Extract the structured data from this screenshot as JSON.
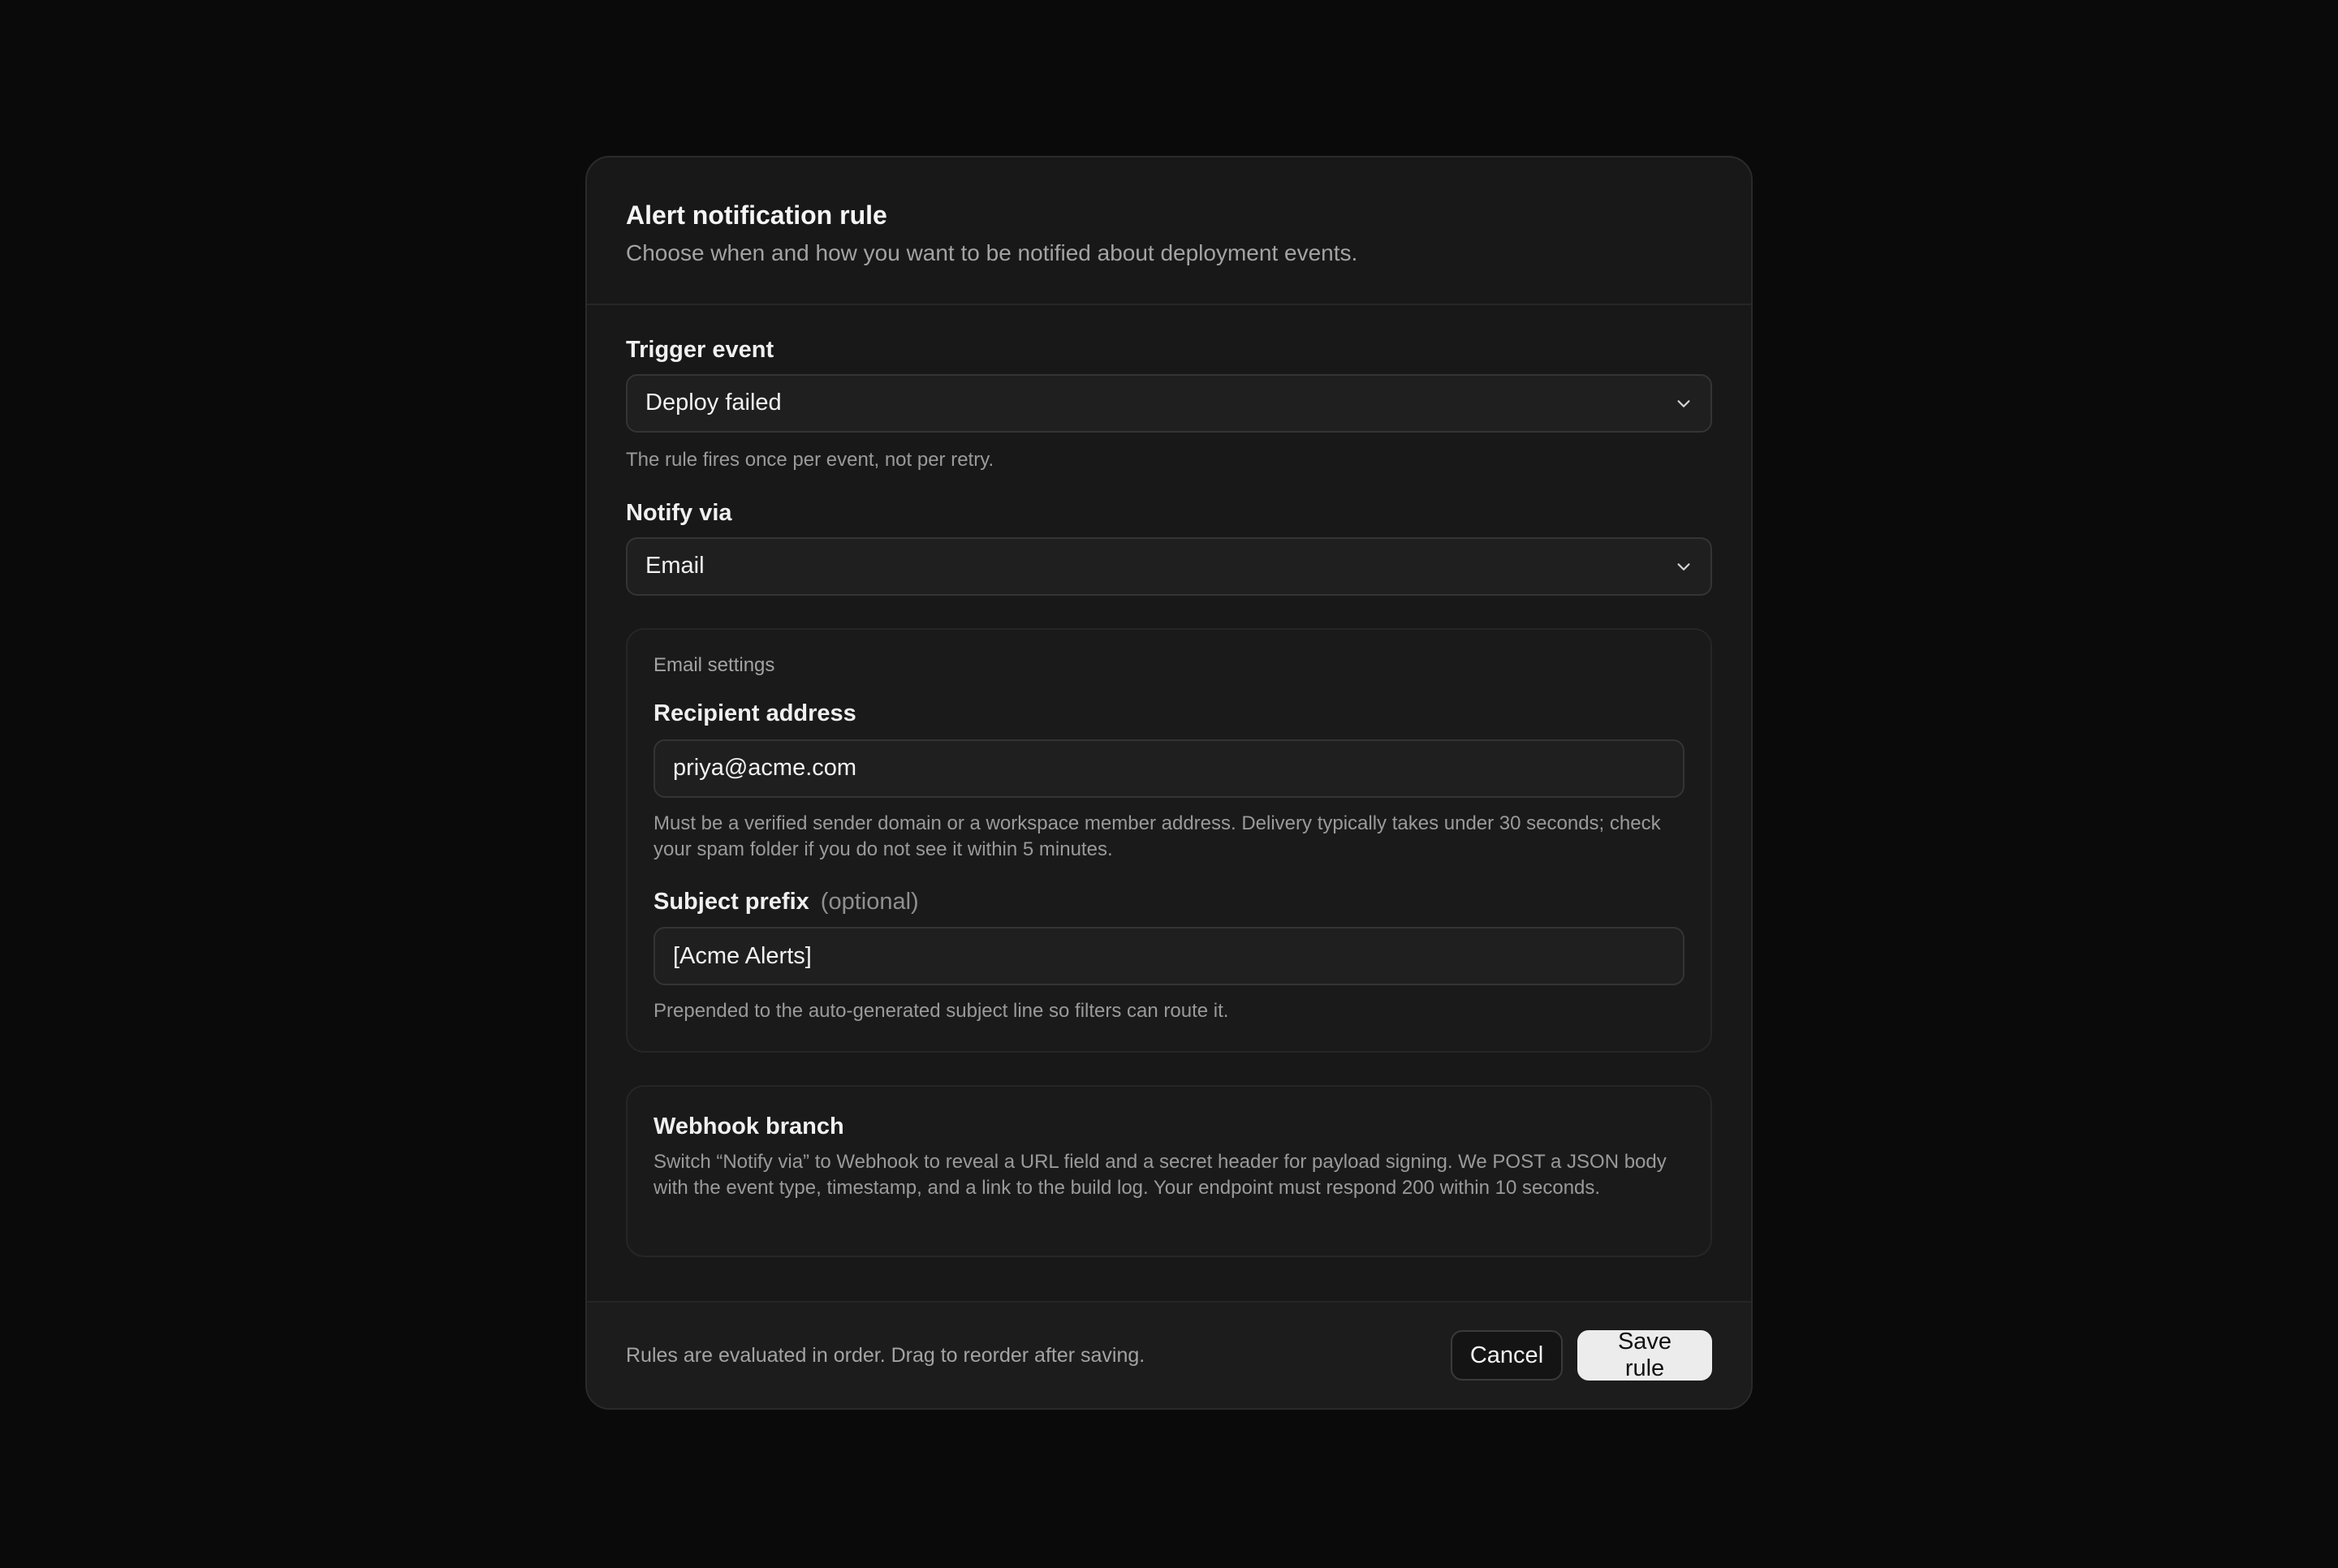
{
  "dialog": {
    "title": "Alert notification rule",
    "subtitle": "Choose when and how you want to be notified about deployment events."
  },
  "trigger": {
    "label": "Trigger event",
    "selected": "Deploy failed",
    "helper": "The rule fires once per event, not per retry."
  },
  "notify": {
    "label": "Notify via",
    "selected": "Email"
  },
  "email_settings": {
    "caption": "Email settings",
    "recipient_label": "Recipient address",
    "recipient_value": "priya@acme.com",
    "recipient_helper": "Must be a verified sender domain or a workspace member address. Delivery typically takes under 30 seconds; check your spam folder if you do not see it within 5 minutes.",
    "subject_label": "Subject prefix",
    "subject_optional": "(optional)",
    "subject_value": "[Acme Alerts]",
    "subject_helper": "Prepended to the auto-generated subject line so filters can route it."
  },
  "webhook": {
    "title": "Webhook branch",
    "description": "Switch “Notify via” to Webhook to reveal a URL field and a secret header for payload signing. We POST a JSON body with the event type, timestamp, and a link to the build log. Your endpoint must respond 200 within 10 seconds."
  },
  "footer": {
    "note": "Rules are evaluated in order. Drag to reorder after saving.",
    "cancel_label": "Cancel",
    "save_label": "Save rule"
  },
  "icons": {
    "trigger_chevron": "chevron-down-icon",
    "notify_chevron": "chevron-down-icon"
  },
  "colors": {
    "background": "#0a0a0a",
    "surface": "#181818",
    "primary_button": "#ececec"
  }
}
